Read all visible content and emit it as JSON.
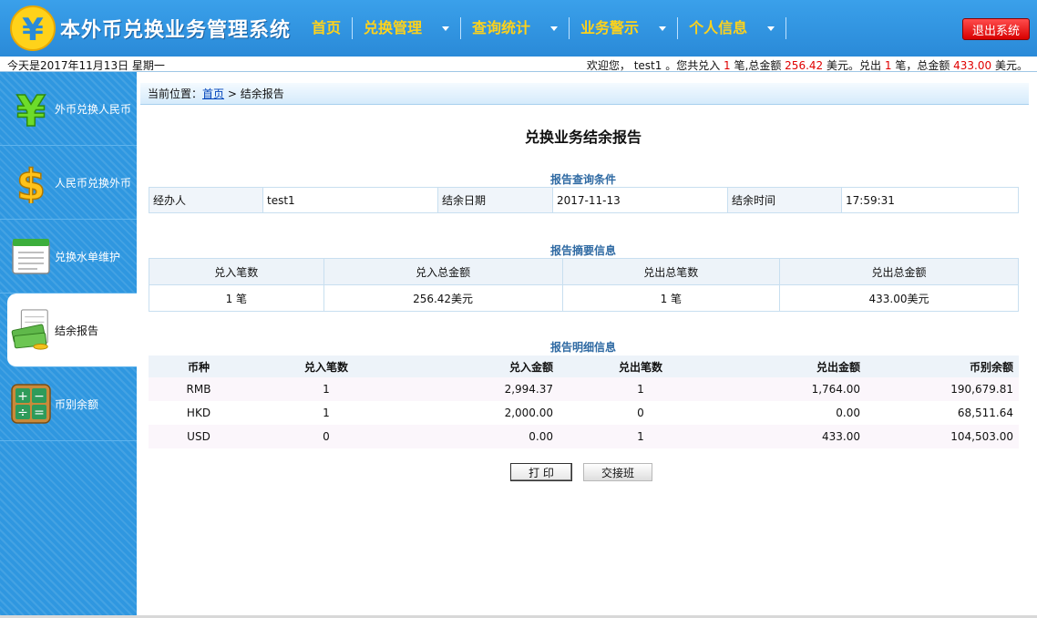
{
  "header": {
    "title": "本外币兑换业务管理系统",
    "nav": [
      {
        "label": "首页",
        "dropdown": false
      },
      {
        "label": "兑换管理",
        "dropdown": true
      },
      {
        "label": "查询统计",
        "dropdown": true
      },
      {
        "label": "业务警示",
        "dropdown": true
      },
      {
        "label": "个人信息",
        "dropdown": true
      }
    ],
    "logout_label": "退出系统"
  },
  "infobar": {
    "date_text": "今天是2017年11月13日 星期一",
    "welcome_prefix": "欢迎您， test1 。您共兑入",
    "in_count": "1",
    "welcome_mid1": "笔,总金额",
    "in_amount": "256.42",
    "welcome_mid2": "美元。兑出",
    "out_count": "1",
    "welcome_mid3": "笔，总金额",
    "out_amount": "433.00",
    "welcome_suffix": "美元。"
  },
  "sidebar": {
    "items": [
      {
        "label": "外币兑换人民币",
        "icon": "yen-icon",
        "active": false
      },
      {
        "label": "人民币兑换外币",
        "icon": "dollar-icon",
        "active": false
      },
      {
        "label": "兑换水单维护",
        "icon": "notepad-icon",
        "active": false
      },
      {
        "label": "结余报告",
        "icon": "money-report-icon",
        "active": true
      },
      {
        "label": "币别余额",
        "icon": "calculator-icon",
        "active": false
      }
    ]
  },
  "breadcrumb": {
    "prefix": "当前位置：",
    "home": "首页",
    "sep": " > ",
    "current": "结余报告"
  },
  "report": {
    "title": "兑换业务结余报告",
    "conditions": {
      "section_title": "报告查询条件",
      "operator_label": "经办人",
      "operator_value": "test1",
      "date_label": "结余日期",
      "date_value": "2017-11-13",
      "time_label": "结余时间",
      "time_value": "17:59:31"
    },
    "summary": {
      "section_title": "报告摘要信息",
      "headers": [
        "兑入笔数",
        "兑入总金额",
        "兑出总笔数",
        "兑出总金额"
      ],
      "values": [
        "1 笔",
        "256.42美元",
        "1 笔",
        "433.00美元"
      ]
    },
    "detail": {
      "section_title": "报告明细信息",
      "headers": [
        "币种",
        "兑入笔数",
        "兑入金额",
        "兑出笔数",
        "兑出金额",
        "币别余额"
      ],
      "rows": [
        [
          "RMB",
          "1",
          "2,994.37",
          "1",
          "1,764.00",
          "190,679.81"
        ],
        [
          "HKD",
          "1",
          "2,000.00",
          "0",
          "0.00",
          "68,511.64"
        ],
        [
          "USD",
          "0",
          "0.00",
          "1",
          "433.00",
          "104,503.00"
        ]
      ]
    },
    "buttons": {
      "print_label": "打 印",
      "shift_label": "交接班"
    }
  },
  "colors": {
    "header_blue": "#2a8ad8",
    "nav_yellow": "#ffd21a",
    "logout_red": "#d80000",
    "highlight_red": "#e00000",
    "section_title_blue": "#2f6aa3"
  }
}
